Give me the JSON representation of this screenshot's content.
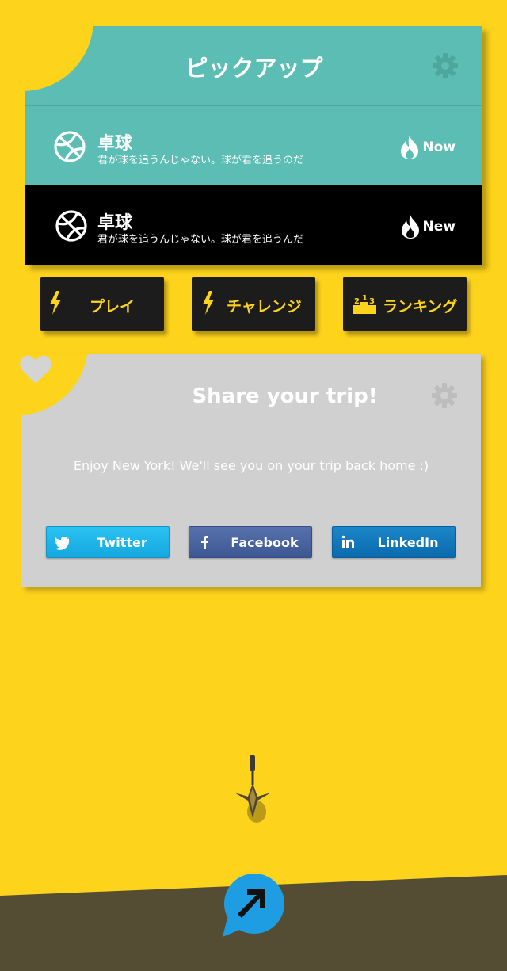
{
  "pickup": {
    "title": "ピックアップ",
    "items": [
      {
        "title": "卓球",
        "subtitle": "君が球を追うんじゃない。球が君を追うのだ",
        "badge": "Now",
        "icon": "basketball-icon"
      },
      {
        "title": "卓球",
        "subtitle": "君が球を追うんじゃない。球が君を追うんだ",
        "badge": "New",
        "icon": "basketball-icon"
      }
    ]
  },
  "actions": {
    "play": "プレイ",
    "challenge": "チャレンジ",
    "ranking": "ランキング"
  },
  "share": {
    "title": "Share your trip!",
    "message": "Enjoy New York! We'll see you on your trip back home :)",
    "twitter": "Twitter",
    "facebook": "Facebook",
    "linkedin": "LinkedIn"
  },
  "colors": {
    "background": "#fdd31c",
    "teal": "#5bbdb4",
    "ground": "#554d33",
    "fab": "#1e9de3"
  }
}
